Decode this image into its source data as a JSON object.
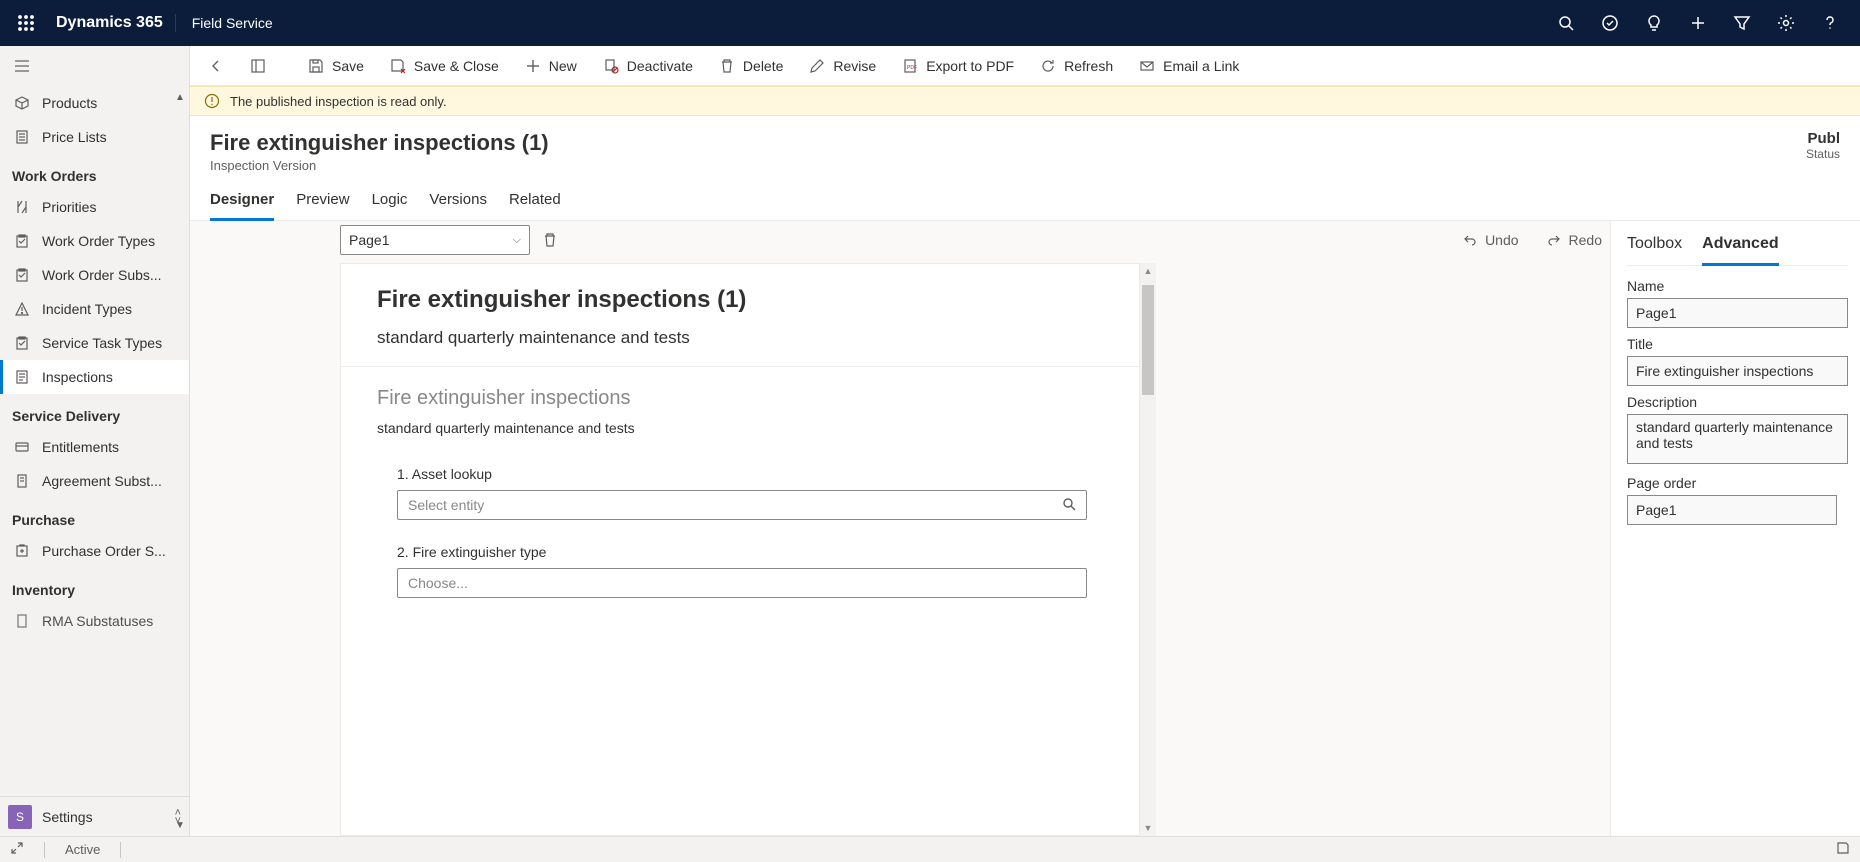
{
  "topbar": {
    "brand": "Dynamics 365",
    "app": "Field Service"
  },
  "sidebar": {
    "top_items": [
      {
        "icon": "box",
        "label": "Products"
      },
      {
        "icon": "list",
        "label": "Price Lists"
      }
    ],
    "groups": [
      {
        "title": "Work Orders",
        "items": [
          {
            "icon": "priority",
            "label": "Priorities"
          },
          {
            "icon": "clipboard",
            "label": "Work Order Types"
          },
          {
            "icon": "clipboard",
            "label": "Work Order Subs..."
          },
          {
            "icon": "warning",
            "label": "Incident Types"
          },
          {
            "icon": "clipboard",
            "label": "Service Task Types"
          },
          {
            "icon": "inspection",
            "label": "Inspections",
            "selected": true
          }
        ]
      },
      {
        "title": "Service Delivery",
        "items": [
          {
            "icon": "entitle",
            "label": "Entitlements"
          },
          {
            "icon": "doc",
            "label": "Agreement Subst..."
          }
        ]
      },
      {
        "title": "Purchase",
        "items": [
          {
            "icon": "po",
            "label": "Purchase Order S..."
          }
        ]
      },
      {
        "title": "Inventory",
        "items": [
          {
            "icon": "doc",
            "label": "RMA Substatuses"
          }
        ]
      }
    ],
    "footer_initial": "S",
    "footer_label": "Settings"
  },
  "cmdbar": {
    "save": "Save",
    "save_close": "Save & Close",
    "new": "New",
    "deactivate": "Deactivate",
    "delete": "Delete",
    "revise": "Revise",
    "export": "Export to PDF",
    "refresh": "Refresh",
    "email": "Email a Link"
  },
  "notice": "The published inspection is read only.",
  "header": {
    "title": "Fire extinguisher inspections (1)",
    "subtitle": "Inspection Version",
    "status_value": "Publ",
    "status_label": "Status"
  },
  "tabs": [
    "Designer",
    "Preview",
    "Logic",
    "Versions",
    "Related"
  ],
  "active_tab": "Designer",
  "designer": {
    "page_selector": "Page1",
    "undo": "Undo",
    "redo": "Redo",
    "canvas": {
      "title": "Fire extinguisher inspections (1)",
      "desc": "standard quarterly maintenance and tests",
      "section_title": "Fire extinguisher inspections",
      "section_desc": "standard quarterly maintenance and tests",
      "q1_label": "1. Asset lookup",
      "q1_placeholder": "Select entity",
      "q2_label": "2. Fire extinguisher type",
      "q2_placeholder": "Choose..."
    }
  },
  "right": {
    "tabs": [
      "Toolbox",
      "Advanced"
    ],
    "active": "Advanced",
    "name_label": "Name",
    "name_value": "Page1",
    "title_label": "Title",
    "title_value": "Fire extinguisher inspections",
    "desc_label": "Description",
    "desc_value": "standard quarterly maintenance and tests",
    "order_label": "Page order",
    "order_value": "Page1"
  },
  "statusbar": {
    "state": "Active"
  }
}
